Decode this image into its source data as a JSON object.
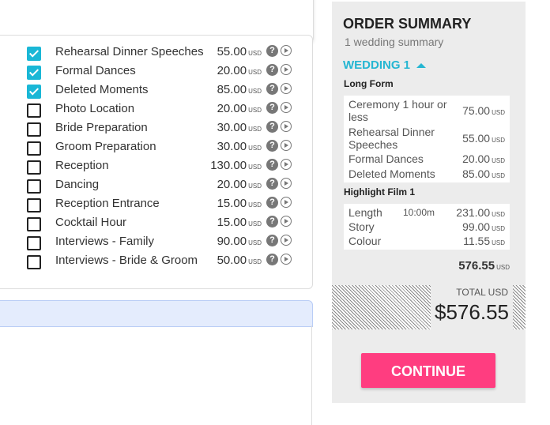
{
  "options": [
    {
      "label": "Rehearsal Dinner Speeches",
      "price": "55.00",
      "currency": "USD",
      "checked": true
    },
    {
      "label": "Formal Dances",
      "price": "20.00",
      "currency": "USD",
      "checked": true
    },
    {
      "label": "Deleted Moments",
      "price": "85.00",
      "currency": "USD",
      "checked": true
    },
    {
      "label": "Photo Location",
      "price": "20.00",
      "currency": "USD",
      "checked": false
    },
    {
      "label": "Bride Preparation",
      "price": "30.00",
      "currency": "USD",
      "checked": false
    },
    {
      "label": "Groom Preparation",
      "price": "30.00",
      "currency": "USD",
      "checked": false
    },
    {
      "label": "Reception",
      "price": "130.00",
      "currency": "USD",
      "checked": false
    },
    {
      "label": "Dancing",
      "price": "20.00",
      "currency": "USD",
      "checked": false
    },
    {
      "label": "Reception Entrance",
      "price": "15.00",
      "currency": "USD",
      "checked": false
    },
    {
      "label": "Cocktail Hour",
      "price": "15.00",
      "currency": "USD",
      "checked": false
    },
    {
      "label": "Interviews - Family",
      "price": "90.00",
      "currency": "USD",
      "checked": false
    },
    {
      "label": "Interviews - Bride & Groom",
      "price": "50.00",
      "currency": "USD",
      "checked": false
    }
  ],
  "option_icons": {
    "help": "?",
    "play": "play-icon"
  },
  "summary": {
    "title": "ORDER SUMMARY",
    "subtitle": "1 wedding summary",
    "wedding_label": "WEDDING 1",
    "long_form": {
      "heading": "Long Form",
      "items": [
        {
          "name": "Ceremony 1 hour or less",
          "price": "75.00",
          "currency": "USD"
        },
        {
          "name": "Rehearsal Dinner Speeches",
          "price": "55.00",
          "currency": "USD"
        },
        {
          "name": "Formal Dances",
          "price": "20.00",
          "currency": "USD"
        },
        {
          "name": "Deleted Moments",
          "price": "85.00",
          "currency": "USD"
        }
      ]
    },
    "highlight": {
      "heading": "Highlight Film 1",
      "items": [
        {
          "name": "Length",
          "detail": "10:00m",
          "price": "231.00",
          "currency": "USD"
        },
        {
          "name": "Story",
          "detail": "",
          "price": "99.00",
          "currency": "USD"
        },
        {
          "name": "Colour",
          "detail": "",
          "price": "11.55",
          "currency": "USD"
        }
      ]
    },
    "subtotal": "576.55",
    "subtotal_currency": "USD",
    "total_label": "TOTAL USD",
    "total_value": "$576.55",
    "continue_label": "CONTINUE"
  },
  "colors": {
    "accent": "#25b6d2",
    "checkbox": "#1ab7d6",
    "continue": "#ff3d80",
    "panel": "#ececec"
  }
}
